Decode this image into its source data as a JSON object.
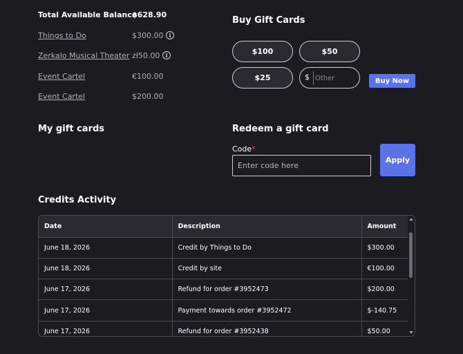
{
  "balance": {
    "total_label": "Total Available Balance",
    "total_amount": "$628.90",
    "rows": [
      {
        "label": "Things to Do",
        "amount": "$300.00",
        "info": true
      },
      {
        "label": "Zerkalo Musical Theater",
        "amount": "zł50.00",
        "info": true
      },
      {
        "label": "Event Cartel",
        "amount": "€100.00",
        "info": false
      },
      {
        "label": "Event Cartel",
        "amount": "$200.00",
        "info": false
      }
    ],
    "info_glyph": "i"
  },
  "buy": {
    "title": "Buy Gift Cards",
    "amounts": [
      "$100",
      "$50",
      "$25"
    ],
    "other_currency": "$",
    "other_placeholder": "Other",
    "buy_now_label": "Buy Now"
  },
  "my_cards": {
    "title": "My gift cards"
  },
  "redeem": {
    "title": "Redeem a gift card",
    "code_label": "Code",
    "required_mark": "*",
    "code_placeholder": "Enter code here",
    "apply_label": "Apply"
  },
  "credits": {
    "title": "Credits Activity",
    "columns": [
      "Date",
      "Description",
      "Amount"
    ],
    "rows": [
      [
        "June 18, 2026",
        "Credit by Things to Do",
        "$300.00"
      ],
      [
        "June 18, 2026",
        "Credit by site",
        "€100.00"
      ],
      [
        "June 17, 2026",
        "Refund for order #3952473",
        "$200.00"
      ],
      [
        "June 17, 2026",
        "Payment towards order #3952472",
        "$-140.75"
      ],
      [
        "June 17, 2026",
        "Refund for order #3952438",
        "$50.00"
      ]
    ]
  },
  "colors": {
    "background": "#1c1b20",
    "accent": "#5b73e8",
    "required": "#e5484d"
  }
}
